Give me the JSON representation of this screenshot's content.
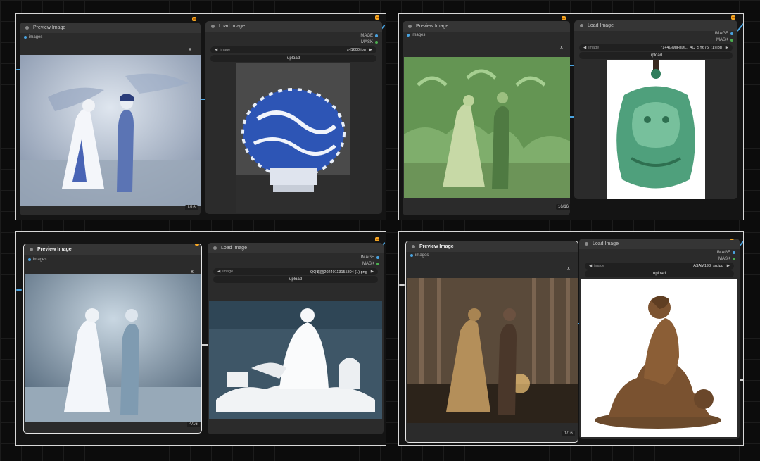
{
  "panels": [
    {
      "preview": {
        "title": "Preview Image",
        "input_label": "images",
        "close": "x",
        "counter": "1/16"
      },
      "load": {
        "title": "Load Image",
        "out_image": "IMAGE",
        "out_mask": "MASK",
        "combo_label": "image",
        "filename": "s-l1600.jpg",
        "upload": "upload"
      },
      "generated_image": "blue-white porcelain wedding couple figurine",
      "source_image": "blue and white porcelain vase"
    },
    {
      "preview": {
        "title": "Preview Image",
        "input_label": "images",
        "close": "x",
        "counter": "16/16"
      },
      "load": {
        "title": "Load Image",
        "out_image": "IMAGE",
        "out_mask": "MASK",
        "combo_label": "image",
        "filename": "71+4GwuFnDL._AC_SY675_(1).jpg",
        "upload": "upload"
      },
      "generated_image": "green jade wedding couple figurine",
      "source_image": "green jade dragon pendant"
    },
    {
      "preview": {
        "title": "Preview Image",
        "input_label": "images",
        "close": "x",
        "counter": "4/16"
      },
      "load": {
        "title": "Load Image",
        "out_image": "IMAGE",
        "out_mask": "MASK",
        "combo_label": "image",
        "filename": "QQ截图20240113155804 (1).png",
        "upload": "upload"
      },
      "generated_image": "white porcelain wedding couple figurine",
      "source_image": "white porcelain seated figure sculpture"
    },
    {
      "preview": {
        "title": "Preview Image",
        "input_label": "images",
        "close": "x",
        "counter": "1/16"
      },
      "load": {
        "title": "Load Image",
        "out_image": "IMAGE",
        "out_mask": "MASK",
        "combo_label": "image",
        "filename": "ASAM193_sq.jpg",
        "upload": "upload"
      },
      "generated_image": "bronze wedding couple figurine",
      "source_image": "bronze seated woman sculpture"
    }
  ],
  "colors": {
    "image_socket": "#4aa3e0",
    "mask_socket": "#4caf50",
    "badge": "#f5a623"
  },
  "icons": {
    "combo_prev": "triangle-left-icon",
    "combo_next": "triangle-right-icon",
    "badge": "node-status-badge-icon"
  }
}
